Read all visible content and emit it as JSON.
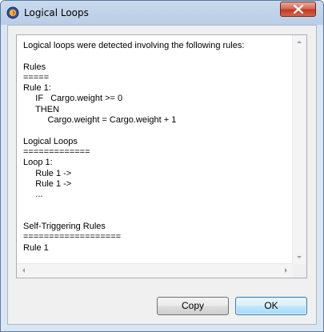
{
  "window": {
    "title": "Logical Loops",
    "icon": "app-logo-icon",
    "close_icon": "close-icon"
  },
  "report": {
    "lines": [
      "Logical loops were detected involving the following rules:",
      "",
      "Rules",
      "=====",
      "Rule 1:",
      "     IF   Cargo.weight >= 0",
      "     THEN",
      "          Cargo.weight = Cargo.weight + 1",
      "",
      "Logical Loops",
      "=============",
      "Loop 1:",
      "     Rule 1 ->",
      "     Rule 1 ->",
      "     ...",
      "",
      "",
      "Self-Triggering Rules",
      "===================",
      "Rule 1"
    ],
    "text": "Logical loops were detected involving the following rules:\n\nRules\n=====\nRule 1:\n     IF   Cargo.weight >= 0\n     THEN\n          Cargo.weight = Cargo.weight + 1\n\nLogical Loops\n=============\nLoop 1:\n     Rule 1 ->\n     Rule 1 ->\n     ...\n\n\nSelf-Triggering Rules\n===================\nRule 1"
  },
  "buttons": {
    "copy_label": "Copy",
    "ok_label": "OK"
  },
  "colors": {
    "title_bar": "#c9daee",
    "close_button": "#c13a22",
    "ok_border": "#3c7fb1"
  }
}
